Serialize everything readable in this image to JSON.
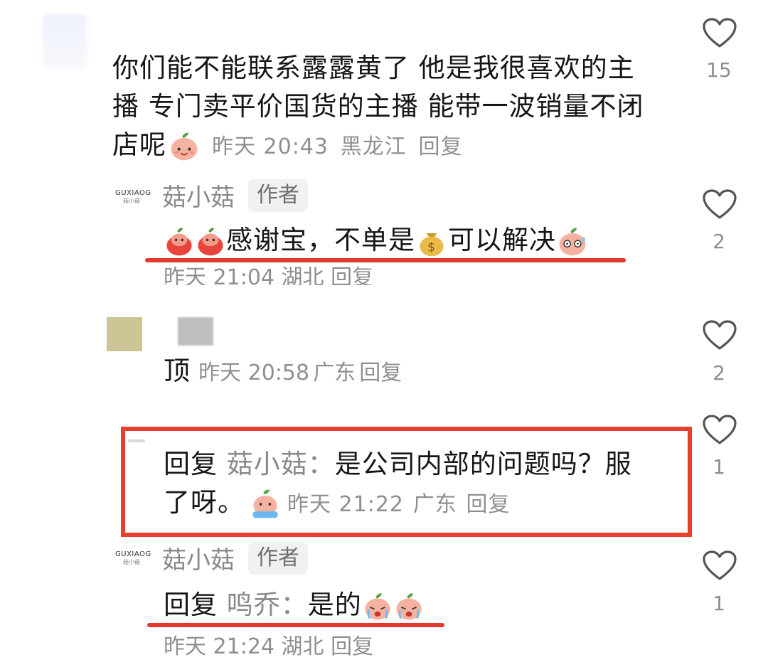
{
  "colors": {
    "accent_red": "#e8402f",
    "meta_gray": "#8f8f8f",
    "text": "#161616"
  },
  "comment1": {
    "text_line1": "你们能不能联系露露黄了 他是我很喜欢的主",
    "text_line2": "播  专门卖平价国货的主播 能带一波销量不闭",
    "text_line3": "店呢",
    "time": "昨天 20:43",
    "location": "黑龙江",
    "reply": "回复",
    "likes": "15"
  },
  "reply1": {
    "logo_line1": "GUXIAOG",
    "logo_line2": "菇小菇",
    "author": "菇小菇",
    "author_tag": "作者",
    "text": "感谢宝，不单是",
    "text2": "可以解决",
    "time": "昨天 21:04",
    "location": "湖北",
    "reply": "回复",
    "likes": "2"
  },
  "reply2": {
    "text": "顶",
    "time": "昨天 20:58",
    "location": "广东",
    "reply": "回复",
    "likes": "2"
  },
  "reply3": {
    "prefix": "回复",
    "target": "菇小菇：",
    "text_line1": "是公司内部的问题吗？服",
    "text_line2": "了呀。",
    "time": "昨天 21:22",
    "location": "广东",
    "reply": "回复",
    "likes": "1"
  },
  "reply4": {
    "logo_line1": "GUXIAOG",
    "logo_line2": "菇小菇",
    "author": "菇小菇",
    "author_tag": "作者",
    "prefix": "回复",
    "target": "鸣乔：",
    "text": "是的",
    "time": "昨天 21:24",
    "location": "湖北",
    "reply": "回复",
    "likes": "1"
  }
}
